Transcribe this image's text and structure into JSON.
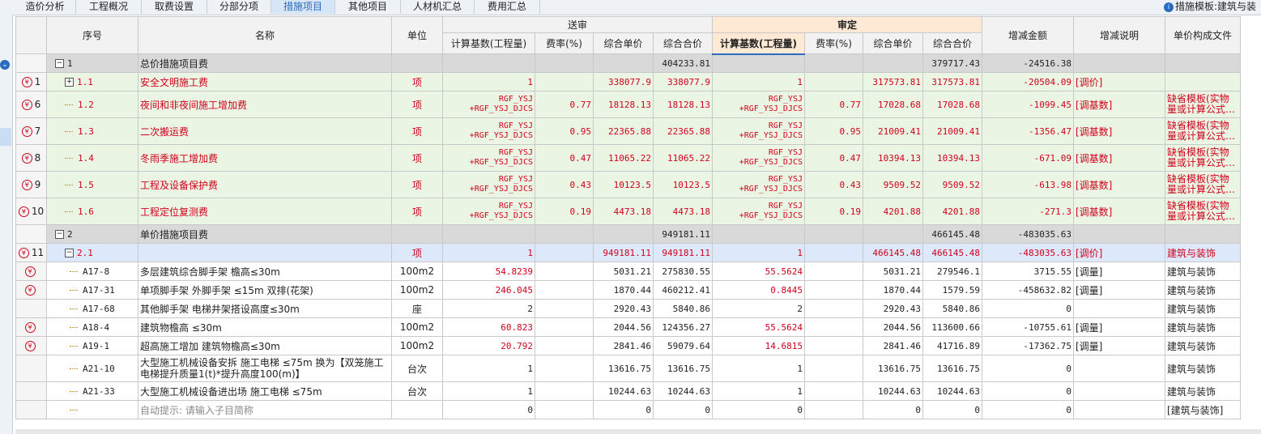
{
  "tabs": [
    {
      "label": "造价分析",
      "active": false
    },
    {
      "label": "工程概况",
      "active": false
    },
    {
      "label": "取费设置",
      "active": false
    },
    {
      "label": "分部分项",
      "active": false
    },
    {
      "label": "措施项目",
      "active": true
    },
    {
      "label": "其他项目",
      "active": false
    },
    {
      "label": "人材机汇总",
      "active": false
    },
    {
      "label": "费用汇总",
      "active": false
    }
  ],
  "template_label": "措施模板:建筑与装",
  "header": {
    "seq": "序号",
    "name": "名称",
    "unit": "单位",
    "songshen": "送审",
    "shending": "审定",
    "base": "计算基数(工程量)",
    "rate": "费率(%)",
    "uprice": "综合单价",
    "total": "综合合价",
    "diff": "增减金额",
    "note": "增减说明",
    "file": "单价构成文件"
  },
  "rows": [
    {
      "cls": "grp",
      "rowno": "",
      "icon": false,
      "tree": "minus",
      "indent": 0,
      "seq": "1",
      "seqRed": false,
      "name": "总价措施项目费",
      "nameRed": false,
      "unit": "",
      "s_base": "",
      "s_rate": "",
      "s_price": "",
      "s_total": "404233.81",
      "d_base": "",
      "d_rate": "",
      "d_price": "",
      "d_total": "379717.43",
      "diff": "-24516.38",
      "note": "",
      "file": ""
    },
    {
      "cls": "gr",
      "rowno": "1",
      "icon": true,
      "tree": "plus",
      "indent": 1,
      "seq": "1.1",
      "seqRed": true,
      "name": "安全文明施工费",
      "nameRed": true,
      "unit": "项",
      "s_base": "1",
      "s_rate": "",
      "s_price": "338077.9",
      "s_total": "338077.9",
      "d_base": "1",
      "d_rate": "",
      "d_price": "317573.81",
      "d_total": "317573.81",
      "diff": "-20504.09",
      "note": "[调价]",
      "file": ""
    },
    {
      "cls": "gr",
      "rowno": "6",
      "icon": true,
      "tree": "line",
      "indent": 1,
      "seq": "1.2",
      "seqRed": true,
      "name": "夜间和非夜间施工增加费",
      "nameRed": true,
      "unit": "项",
      "s_base": "RGF_YSJ\n+RGF_YSJ_DJCS",
      "s_rate": "0.77",
      "s_price": "18128.13",
      "s_total": "18128.13",
      "d_base": "RGF_YSJ\n+RGF_YSJ_DJCS",
      "d_rate": "0.77",
      "d_price": "17028.68",
      "d_total": "17028.68",
      "diff": "-1099.45",
      "note": "[调基数]",
      "file": "缺省模板(实物\n量或计算公式…"
    },
    {
      "cls": "gr",
      "rowno": "7",
      "icon": true,
      "tree": "line",
      "indent": 1,
      "seq": "1.3",
      "seqRed": true,
      "name": "二次搬运费",
      "nameRed": true,
      "unit": "项",
      "s_base": "RGF_YSJ\n+RGF_YSJ_DJCS",
      "s_rate": "0.95",
      "s_price": "22365.88",
      "s_total": "22365.88",
      "d_base": "RGF_YSJ\n+RGF_YSJ_DJCS",
      "d_rate": "0.95",
      "d_price": "21009.41",
      "d_total": "21009.41",
      "diff": "-1356.47",
      "note": "[调基数]",
      "file": "缺省模板(实物\n量或计算公式…"
    },
    {
      "cls": "gr",
      "rowno": "8",
      "icon": true,
      "tree": "line",
      "indent": 1,
      "seq": "1.4",
      "seqRed": true,
      "name": "冬雨季施工增加费",
      "nameRed": true,
      "unit": "项",
      "s_base": "RGF_YSJ\n+RGF_YSJ_DJCS",
      "s_rate": "0.47",
      "s_price": "11065.22",
      "s_total": "11065.22",
      "d_base": "RGF_YSJ\n+RGF_YSJ_DJCS",
      "d_rate": "0.47",
      "d_price": "10394.13",
      "d_total": "10394.13",
      "diff": "-671.09",
      "note": "[调基数]",
      "file": "缺省模板(实物\n量或计算公式…"
    },
    {
      "cls": "gr",
      "rowno": "9",
      "icon": true,
      "tree": "line",
      "indent": 1,
      "seq": "1.5",
      "seqRed": true,
      "name": "工程及设备保护费",
      "nameRed": true,
      "unit": "项",
      "s_base": "RGF_YSJ\n+RGF_YSJ_DJCS",
      "s_rate": "0.43",
      "s_price": "10123.5",
      "s_total": "10123.5",
      "d_base": "RGF_YSJ\n+RGF_YSJ_DJCS",
      "d_rate": "0.43",
      "d_price": "9509.52",
      "d_total": "9509.52",
      "diff": "-613.98",
      "note": "[调基数]",
      "file": "缺省模板(实物\n量或计算公式…"
    },
    {
      "cls": "gr",
      "rowno": "10",
      "icon": true,
      "tree": "line",
      "indent": 1,
      "seq": "1.6",
      "seqRed": true,
      "name": "工程定位复测费",
      "nameRed": true,
      "unit": "项",
      "s_base": "RGF_YSJ\n+RGF_YSJ_DJCS",
      "s_rate": "0.19",
      "s_price": "4473.18",
      "s_total": "4473.18",
      "d_base": "RGF_YSJ\n+RGF_YSJ_DJCS",
      "d_rate": "0.19",
      "d_price": "4201.88",
      "d_total": "4201.88",
      "diff": "-271.3",
      "note": "[调基数]",
      "file": "缺省模板(实物\n量或计算公式…"
    },
    {
      "cls": "grp",
      "rowno": "",
      "icon": false,
      "tree": "minus",
      "indent": 0,
      "seq": "2",
      "seqRed": false,
      "name": "单价措施项目费",
      "nameRed": false,
      "unit": "",
      "s_base": "",
      "s_rate": "",
      "s_price": "",
      "s_total": "949181.11",
      "d_base": "",
      "d_rate": "",
      "d_price": "",
      "d_total": "466145.48",
      "diff": "-483035.63",
      "note": "",
      "file": ""
    },
    {
      "cls": "bl",
      "rowno": "11",
      "icon": true,
      "tree": "minus",
      "indent": 1,
      "seq": "2.1",
      "seqRed": true,
      "name": "",
      "nameRed": true,
      "unit": "项",
      "s_base": "1",
      "s_rate": "",
      "s_price": "949181.11",
      "s_total": "949181.11",
      "d_base": "1",
      "d_rate": "",
      "d_price": "466145.48",
      "d_total": "466145.48",
      "diff": "-483035.63",
      "note": "[调价]",
      "file": "建筑与装饰"
    },
    {
      "cls": "w",
      "rowno": "",
      "icon": true,
      "tree": "line",
      "indent": 2,
      "seq": "A17-8",
      "seqRed": false,
      "name": "多层建筑综合脚手架 檐高≤30m",
      "nameRed": false,
      "unit": "100m2",
      "s_base": "54.8239",
      "s_rate": "",
      "s_price": "5031.21",
      "s_total": "275830.55",
      "d_base": "55.5624",
      "d_rate": "",
      "d_price": "5031.21",
      "d_total": "279546.1",
      "diff": "3715.55",
      "note": "[调量]",
      "file": "建筑与装饰"
    },
    {
      "cls": "w",
      "rowno": "",
      "icon": true,
      "tree": "line",
      "indent": 2,
      "seq": "A17-31",
      "seqRed": false,
      "name": "单项脚手架 外脚手架 ≤15m 双排(花架)",
      "nameRed": false,
      "unit": "100m2",
      "s_base": "246.045",
      "s_rate": "",
      "s_price": "1870.44",
      "s_total": "460212.41",
      "d_base": "0.8445",
      "d_rate": "",
      "d_price": "1870.44",
      "d_total": "1579.59",
      "diff": "-458632.82",
      "note": "[调量]",
      "file": "建筑与装饰"
    },
    {
      "cls": "w",
      "rowno": "",
      "icon": false,
      "tree": "line",
      "indent": 2,
      "seq": "A17-68",
      "seqRed": false,
      "name": "其他脚手架 电梯井架搭设高度≤30m",
      "nameRed": false,
      "unit": "座",
      "s_base": "2",
      "s_rate": "",
      "s_price": "2920.43",
      "s_total": "5840.86",
      "d_base": "2",
      "d_rate": "",
      "d_price": "2920.43",
      "d_total": "5840.86",
      "diff": "0",
      "note": "",
      "file": "建筑与装饰"
    },
    {
      "cls": "w",
      "rowno": "",
      "icon": true,
      "tree": "line",
      "indent": 2,
      "seq": "A18-4",
      "seqRed": false,
      "name": "建筑物檐高 ≤30m",
      "nameRed": false,
      "unit": "100m2",
      "s_base": "60.823",
      "s_rate": "",
      "s_price": "2044.56",
      "s_total": "124356.27",
      "d_base": "55.5624",
      "d_rate": "",
      "d_price": "2044.56",
      "d_total": "113600.66",
      "diff": "-10755.61",
      "note": "[调量]",
      "file": "建筑与装饰"
    },
    {
      "cls": "w",
      "rowno": "",
      "icon": true,
      "tree": "line",
      "indent": 2,
      "seq": "A19-1",
      "seqRed": false,
      "name": "超高施工增加 建筑物檐高≤30m",
      "nameRed": false,
      "unit": "100m2",
      "s_base": "20.792",
      "s_rate": "",
      "s_price": "2841.46",
      "s_total": "59079.64",
      "d_base": "14.6815",
      "d_rate": "",
      "d_price": "2841.46",
      "d_total": "41716.89",
      "diff": "-17362.75",
      "note": "[调量]",
      "file": "建筑与装饰"
    },
    {
      "cls": "w",
      "rowno": "",
      "icon": false,
      "tree": "line",
      "indent": 2,
      "seq": "A21-10",
      "seqRed": false,
      "name": "大型施工机械设备安拆 施工电梯 ≤75m  换为【双笼施工\n电梯提升质量1(t)*提升高度100(m)】",
      "nameRed": false,
      "unit": "台次",
      "s_base": "1",
      "s_rate": "",
      "s_price": "13616.75",
      "s_total": "13616.75",
      "d_base": "1",
      "d_rate": "",
      "d_price": "13616.75",
      "d_total": "13616.75",
      "diff": "0",
      "note": "",
      "file": "建筑与装饰"
    },
    {
      "cls": "w",
      "rowno": "",
      "icon": false,
      "tree": "line",
      "indent": 2,
      "seq": "A21-33",
      "seqRed": false,
      "name": "大型施工机械设备进出场 施工电梯 ≤75m",
      "nameRed": false,
      "unit": "台次",
      "s_base": "1",
      "s_rate": "",
      "s_price": "10244.63",
      "s_total": "10244.63",
      "d_base": "1",
      "d_rate": "",
      "d_price": "10244.63",
      "d_total": "10244.63",
      "diff": "0",
      "note": "",
      "file": "建筑与装饰"
    },
    {
      "cls": "w",
      "rowno": "",
      "icon": false,
      "tree": "line",
      "indent": 2,
      "seq": "",
      "seqRed": false,
      "name": "自动提示: 请输入子目简称",
      "nameRed": false,
      "unit": "",
      "s_base": "0",
      "s_rate": "",
      "s_price": "0",
      "s_total": "0",
      "d_base": "0",
      "d_rate": "",
      "d_price": "0",
      "d_total": "0",
      "diff": "0",
      "note": "",
      "file": "[建筑与装饰]"
    }
  ]
}
